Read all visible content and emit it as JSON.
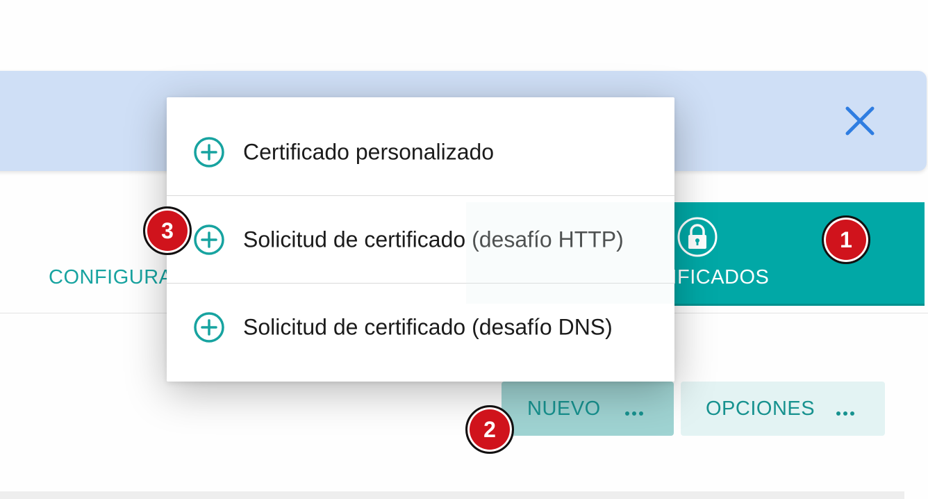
{
  "banner": {
    "close_icon": "close-icon",
    "background": "#cfdff6",
    "close_color": "#2f7de1"
  },
  "tabs": [
    {
      "label": "CONFIGURACIONES VCL",
      "active": false
    },
    {
      "label": "CERTIFICADOS",
      "active": true,
      "icon": "lock-icon"
    }
  ],
  "toolbar": {
    "new_label": "NUEVO",
    "options_label": "OPCIONES",
    "more_icon": "more-dots-icon"
  },
  "menu": {
    "items": [
      {
        "label": "Certificado personalizado",
        "icon": "plus-circle-icon"
      },
      {
        "label": "Solicitud de certificado (desafío HTTP)",
        "icon": "plus-circle-icon"
      },
      {
        "label": "Solicitud de certificado (desafío DNS)",
        "icon": "plus-circle-icon"
      }
    ]
  },
  "callouts": [
    "1",
    "2",
    "3"
  ],
  "colors": {
    "accent": "#01a8a6",
    "accent_text": "#17a3a0",
    "callout_red": "#d0131c"
  }
}
